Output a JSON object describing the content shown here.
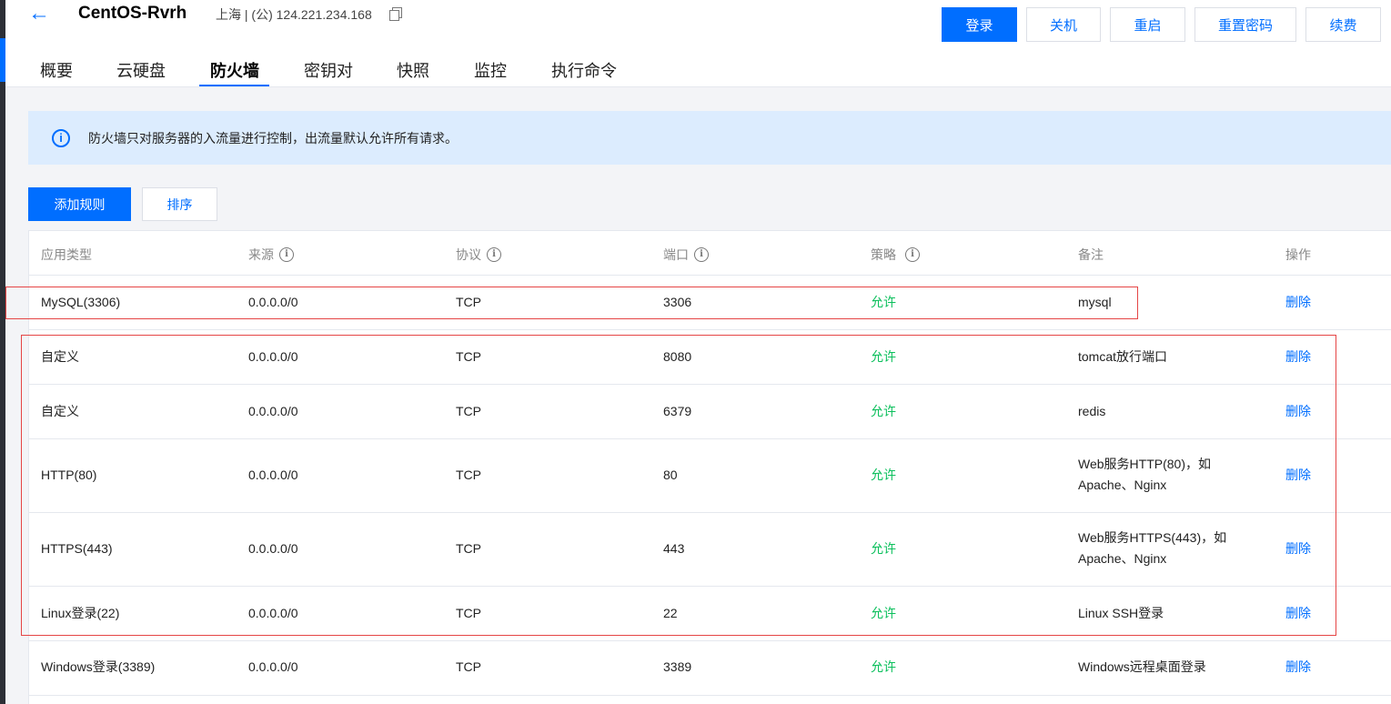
{
  "header": {
    "back_icon": "arrow-left-icon",
    "title": "CentOS-Rvrh",
    "region": "上海 | (公) 124.221.234.168",
    "copy_icon": "copy-icon",
    "buttons": [
      "登录",
      "关机",
      "重启",
      "重置密码",
      "续费"
    ]
  },
  "tabs": [
    "概要",
    "云硬盘",
    "防火墙",
    "密钥对",
    "快照",
    "监控",
    "执行命令"
  ],
  "active_tab": "防火墙",
  "info": {
    "icon": "info-icon",
    "text": "防火墙只对服务器的入流量进行控制，出流量默认允许所有请求。"
  },
  "actions": {
    "add": "添加规则",
    "sort": "排序"
  },
  "table": {
    "columns": [
      "应用类型",
      "来源",
      "协议",
      "端口",
      "策略",
      "备注",
      "操作"
    ],
    "rows": [
      {
        "type": "MySQL(3306)",
        "source": "0.0.0.0/0",
        "protocol": "TCP",
        "port": "3306",
        "policy": "允许",
        "note": "mysql",
        "op": "删除"
      },
      {
        "type": "自定义",
        "source": "0.0.0.0/0",
        "protocol": "TCP",
        "port": "8080",
        "policy": "允许",
        "note": "tomcat放行端口",
        "op": "删除"
      },
      {
        "type": "自定义",
        "source": "0.0.0.0/0",
        "protocol": "TCP",
        "port": "6379",
        "policy": "允许",
        "note": "redis",
        "op": "删除"
      },
      {
        "type": "HTTP(80)",
        "source": "0.0.0.0/0",
        "protocol": "TCP",
        "port": "80",
        "policy": "允许",
        "note": "Web服务HTTP(80)，如Apache、Nginx",
        "op": "删除"
      },
      {
        "type": "HTTPS(443)",
        "source": "0.0.0.0/0",
        "protocol": "TCP",
        "port": "443",
        "policy": "允许",
        "note": "Web服务HTTPS(443)，如Apache、Nginx",
        "op": "删除"
      },
      {
        "type": "Linux登录(22)",
        "source": "0.0.0.0/0",
        "protocol": "TCP",
        "port": "22",
        "policy": "允许",
        "note": "Linux SSH登录",
        "op": "删除"
      },
      {
        "type": "Windows登录(3389)",
        "source": "0.0.0.0/0",
        "protocol": "TCP",
        "port": "3389",
        "policy": "允许",
        "note": "Windows远程桌面登录",
        "op": "删除"
      }
    ]
  },
  "colors": {
    "primary": "#006eff",
    "allow": "#0abf5b",
    "highlight": "#e54545"
  }
}
